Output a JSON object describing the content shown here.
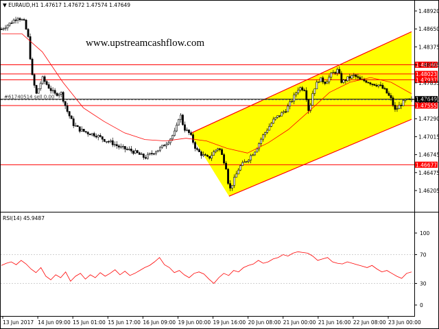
{
  "chart_data": {
    "type": "candlestick",
    "symbol_header": "▼ EURAUD,H1  1.47617 1.47672 1.47574 1.47649",
    "watermark": "www.upstreamcashflow.com",
    "ylim": [
      1.4605,
      1.491
    ],
    "y_ticks": [
      "1.48920",
      "1.48650",
      "1.48375",
      "1.48105",
      "1.47835",
      "1.47560",
      "1.47290",
      "1.47015",
      "1.46745",
      "1.46475",
      "1.46205"
    ],
    "x_tick_labels": [
      "13 Jun 2017",
      "14 Jun 09:00",
      "15 Jun 01:00",
      "15 Jun 17:00",
      "16 Jun 09:00",
      "19 Jun 00:00",
      "19 Jun 16:00",
      "20 Jun 08:00",
      "21 Jun 00:00",
      "21 Jun 16:00",
      "22 Jun 08:00",
      "23 Jun 00:00"
    ],
    "price_levels": [
      {
        "label": "1.48160",
        "value": 1.4816
      },
      {
        "label": "1.48023",
        "value": 1.48023
      },
      {
        "label": "1.47937",
        "value": 1.47937
      },
      {
        "label": "1.47555",
        "value": 1.47555
      },
      {
        "label": "1.46677",
        "value": 1.46677
      }
    ],
    "bid_level": {
      "label": "1.47649",
      "value": 1.47649
    },
    "order_line": {
      "label": "#61740514 sell 0.00",
      "value": 1.4764
    },
    "channel": {
      "upper": [
        [
          0.46,
          1.4714
        ],
        [
          1.0,
          1.4865
        ]
      ],
      "lower_start": [
        0.555,
        1.4621
      ],
      "lower_end": [
        1.0,
        1.4735
      ],
      "fill": "#FFFF00"
    },
    "price_path": [
      [
        0.0,
        1.4869
      ],
      [
        0.02,
        1.4877
      ],
      [
        0.04,
        1.4887
      ],
      [
        0.055,
        1.488
      ],
      [
        0.065,
        1.4858
      ],
      [
        0.075,
        1.48
      ],
      [
        0.085,
        1.4772
      ],
      [
        0.1,
        1.4796
      ],
      [
        0.115,
        1.4783
      ],
      [
        0.13,
        1.4772
      ],
      [
        0.145,
        1.4775
      ],
      [
        0.16,
        1.4748
      ],
      [
        0.175,
        1.4728
      ],
      [
        0.19,
        1.472
      ],
      [
        0.21,
        1.4715
      ],
      [
        0.23,
        1.4712
      ],
      [
        0.25,
        1.4705
      ],
      [
        0.27,
        1.47
      ],
      [
        0.29,
        1.4693
      ],
      [
        0.31,
        1.469
      ],
      [
        0.33,
        1.4685
      ],
      [
        0.35,
        1.4678
      ],
      [
        0.37,
        1.4686
      ],
      [
        0.39,
        1.4693
      ],
      [
        0.41,
        1.4705
      ],
      [
        0.425,
        1.4718
      ],
      [
        0.435,
        1.4745
      ],
      [
        0.445,
        1.4722
      ],
      [
        0.46,
        1.4713
      ],
      [
        0.475,
        1.469
      ],
      [
        0.49,
        1.4682
      ],
      [
        0.505,
        1.4677
      ],
      [
        0.52,
        1.4688
      ],
      [
        0.53,
        1.4694
      ],
      [
        0.54,
        1.4678
      ],
      [
        0.55,
        1.466
      ],
      [
        0.555,
        1.4628
      ],
      [
        0.565,
        1.4642
      ],
      [
        0.58,
        1.4664
      ],
      [
        0.6,
        1.4675
      ],
      [
        0.62,
        1.469
      ],
      [
        0.635,
        1.4708
      ],
      [
        0.65,
        1.4722
      ],
      [
        0.665,
        1.4735
      ],
      [
        0.68,
        1.4742
      ],
      [
        0.695,
        1.475
      ],
      [
        0.71,
        1.4765
      ],
      [
        0.725,
        1.4782
      ],
      [
        0.74,
        1.478
      ],
      [
        0.75,
        1.4745
      ],
      [
        0.76,
        1.4778
      ],
      [
        0.775,
        1.4795
      ],
      [
        0.79,
        1.479
      ],
      [
        0.805,
        1.4802
      ],
      [
        0.82,
        1.4808
      ],
      [
        0.83,
        1.479
      ],
      [
        0.845,
        1.4796
      ],
      [
        0.86,
        1.48
      ],
      [
        0.875,
        1.4793
      ],
      [
        0.89,
        1.4792
      ],
      [
        0.905,
        1.4788
      ],
      [
        0.92,
        1.4786
      ],
      [
        0.935,
        1.4778
      ],
      [
        0.95,
        1.4765
      ],
      [
        0.96,
        1.4748
      ],
      [
        0.97,
        1.4755
      ],
      [
        0.985,
        1.4763
      ]
    ],
    "ma_path": [
      [
        0.0,
        1.4862
      ],
      [
        0.05,
        1.4862
      ],
      [
        0.1,
        1.4835
      ],
      [
        0.15,
        1.479
      ],
      [
        0.2,
        1.4752
      ],
      [
        0.25,
        1.4732
      ],
      [
        0.3,
        1.4715
      ],
      [
        0.35,
        1.4705
      ],
      [
        0.4,
        1.4703
      ],
      [
        0.45,
        1.4707
      ],
      [
        0.5,
        1.4703
      ],
      [
        0.55,
        1.4692
      ],
      [
        0.6,
        1.4685
      ],
      [
        0.65,
        1.47
      ],
      [
        0.7,
        1.472
      ],
      [
        0.75,
        1.4747
      ],
      [
        0.8,
        1.4775
      ],
      [
        0.85,
        1.479
      ],
      [
        0.9,
        1.4797
      ],
      [
        0.95,
        1.479
      ],
      [
        1.0,
        1.4773
      ]
    ],
    "rsi": {
      "label": "RSI(14) 45.9487",
      "ylim": [
        0,
        100
      ],
      "ticks": [
        "100",
        "70",
        "30",
        "0"
      ],
      "values": [
        55,
        58,
        60,
        56,
        62,
        57,
        50,
        45,
        52,
        40,
        35,
        42,
        38,
        46,
        33,
        40,
        44,
        36,
        42,
        38,
        45,
        40,
        44,
        49,
        42,
        47,
        41,
        44,
        48,
        52,
        55,
        60,
        66,
        56,
        52,
        45,
        48,
        42,
        38,
        44,
        46,
        43,
        36,
        30,
        38,
        44,
        41,
        48,
        46,
        52,
        55,
        57,
        62,
        58,
        60,
        64,
        66,
        70,
        68,
        72,
        74,
        73,
        72,
        68,
        62,
        64,
        66,
        60,
        58,
        57,
        60,
        58,
        56,
        54,
        52,
        55,
        50,
        46,
        48,
        44,
        40,
        37,
        44,
        46
      ]
    }
  }
}
